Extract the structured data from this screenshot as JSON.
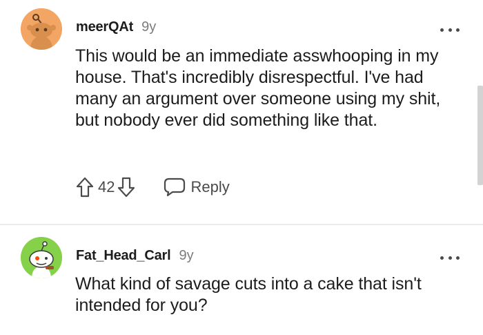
{
  "comments": [
    {
      "username": "meerQAt",
      "time": "9y",
      "avatar_icon": "snoo-avatar-orange-icon",
      "avatar_color": "#f3a563",
      "text": "This would be an immediate asswhooping in my house. That's incredibly disrespectful. I've had many an argument over someone using my shit, but nobody ever did something like that.",
      "score": "42",
      "reply_label": "Reply"
    },
    {
      "username": "Fat_Head_Carl",
      "time": "9y",
      "avatar_icon": "snoo-avatar-green-icon",
      "avatar_color": "#86d14a",
      "text": "What kind of savage cuts into a cake that isn't intended for you?"
    }
  ]
}
